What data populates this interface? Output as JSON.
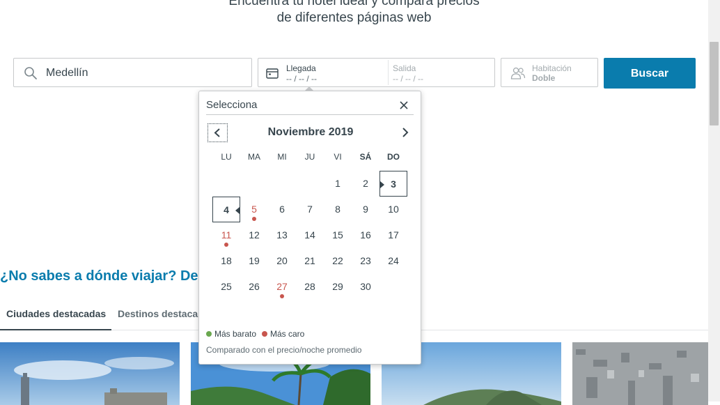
{
  "header": {
    "line1": "Encuentra tu hotel ideal y compara precios",
    "line2": "de diferentes páginas web"
  },
  "search": {
    "destination_value": "Medellín",
    "checkin_label": "Llegada",
    "checkin_value": "-- / -- / --",
    "checkout_label": "Salida",
    "checkout_value": "-- / -- / --",
    "room_label": "Habitación",
    "room_value": "Doble",
    "search_button": "Buscar"
  },
  "calendar": {
    "title": "Selecciona",
    "month": "Noviembre 2019",
    "weekdays": [
      "LU",
      "MA",
      "MI",
      "JU",
      "VI",
      "SÁ",
      "DO"
    ],
    "days": [
      "1",
      "2",
      "3",
      "4",
      "5",
      "6",
      "7",
      "8",
      "9",
      "10",
      "11",
      "12",
      "13",
      "14",
      "15",
      "16",
      "17",
      "18",
      "19",
      "20",
      "21",
      "22",
      "23",
      "24",
      "25",
      "26",
      "27",
      "28",
      "29",
      "30"
    ],
    "legend_cheap": "Más barato",
    "legend_expensive": "Más caro",
    "note": "Comparado con el precio/noche promedio",
    "colors": {
      "cheap": "#6aa84f",
      "expensive": "#c8564e"
    }
  },
  "promo": {
    "heading": "¿No sabes a dónde viajar? De"
  },
  "tabs": {
    "featured_cities": "Ciudades destacadas",
    "featured_destinations": "Destinos destaca"
  },
  "colors": {
    "accent": "#0a7cad",
    "text": "#37454d"
  }
}
